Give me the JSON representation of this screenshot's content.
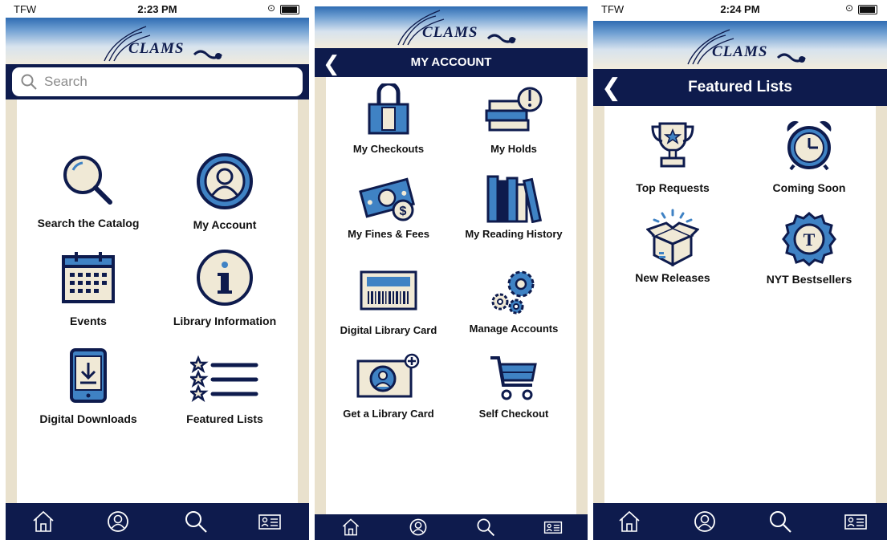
{
  "colors": {
    "navy": "#0e1b4d",
    "accent": "#3f82c4",
    "cream": "#f0e9d6"
  },
  "screen1": {
    "status": {
      "carrier": "TFW",
      "time": "2:23 PM"
    },
    "logo_text": "CLAMS",
    "search": {
      "placeholder": "Search"
    },
    "items": [
      {
        "label": "Search the Catalog",
        "icon": "magnifier-icon"
      },
      {
        "label": "My Account",
        "icon": "user-circle-icon"
      },
      {
        "label": "Events",
        "icon": "calendar-icon"
      },
      {
        "label": "Library Information",
        "icon": "info-icon"
      },
      {
        "label": "Digital Downloads",
        "icon": "tablet-download-icon"
      },
      {
        "label": "Featured Lists",
        "icon": "star-list-icon"
      }
    ]
  },
  "screen2": {
    "logo_text": "CLAMS",
    "header": {
      "title": "MY ACCOUNT"
    },
    "items": [
      {
        "label": "My Checkouts",
        "icon": "bag-icon"
      },
      {
        "label": "My Holds",
        "icon": "books-alert-icon"
      },
      {
        "label": "My Fines & Fees",
        "icon": "money-icon"
      },
      {
        "label": "My Reading History",
        "icon": "bookshelf-icon"
      },
      {
        "label": "Digital Library Card",
        "icon": "barcode-card-icon"
      },
      {
        "label": "Manage Accounts",
        "icon": "gears-icon"
      },
      {
        "label": "Get a Library Card",
        "icon": "id-card-add-icon"
      },
      {
        "label": "Self Checkout",
        "icon": "cart-icon"
      }
    ]
  },
  "screen3": {
    "status": {
      "carrier": "TFW",
      "time": "2:24 PM"
    },
    "logo_text": "CLAMS",
    "header": {
      "title": "Featured Lists"
    },
    "items": [
      {
        "label": "Top Requests",
        "icon": "trophy-icon"
      },
      {
        "label": "Coming Soon",
        "icon": "alarm-clock-icon"
      },
      {
        "label": "New Releases",
        "icon": "open-box-icon"
      },
      {
        "label": "NYT Bestsellers",
        "icon": "nyt-badge-icon"
      }
    ]
  },
  "tabbar": [
    "home-icon",
    "account-icon",
    "search-icon",
    "card-icon"
  ]
}
